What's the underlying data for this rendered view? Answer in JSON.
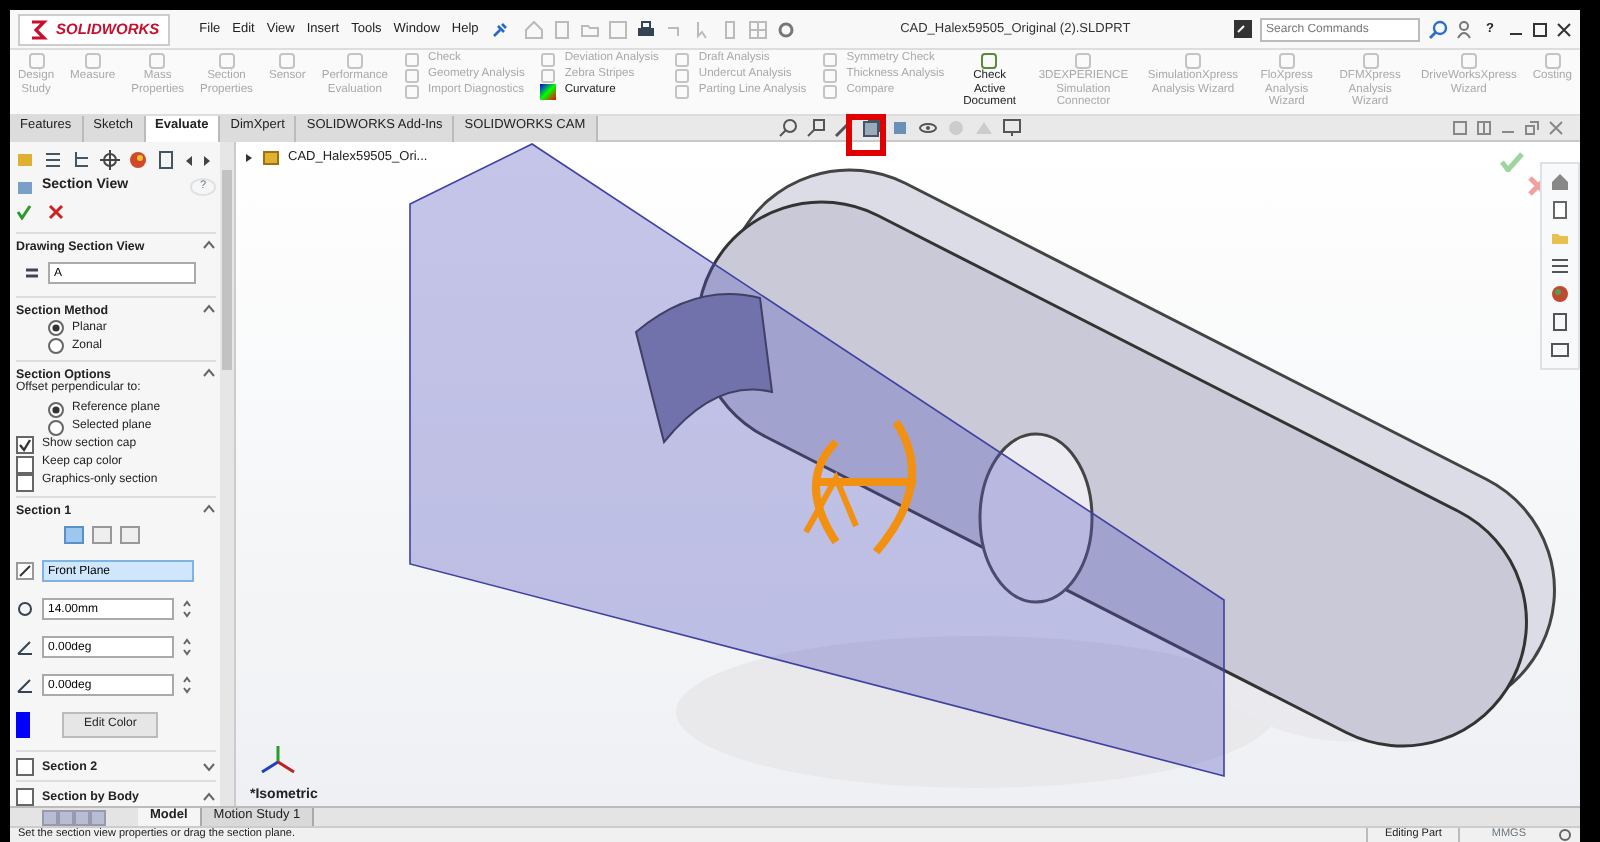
{
  "title_bar": {
    "logo_text": "SOLIDWORKS",
    "menus": [
      "File",
      "Edit",
      "View",
      "Insert",
      "Tools",
      "Window",
      "Help"
    ],
    "document_title": "CAD_Halex59505_Original (2).SLDPRT",
    "search": {
      "placeholder": "Search Commands"
    },
    "help_label": "?"
  },
  "ribbon": {
    "items": [
      {
        "kind": "large",
        "label": "Design Study",
        "disabled": true
      },
      {
        "kind": "large",
        "label": "Measure",
        "disabled": true
      },
      {
        "kind": "large",
        "label": "Mass Properties",
        "disabled": true
      },
      {
        "kind": "large",
        "label": "Section Properties",
        "disabled": true
      },
      {
        "kind": "large",
        "label": "Sensor",
        "disabled": true
      },
      {
        "kind": "large",
        "label": "Performance Evaluation",
        "disabled": true
      },
      {
        "kind": "stack",
        "entries": [
          {
            "label": "Check",
            "disabled": true
          },
          {
            "label": "Geometry Analysis",
            "disabled": true
          },
          {
            "label": "Import Diagnostics",
            "disabled": true
          }
        ]
      },
      {
        "kind": "stack",
        "entries": [
          {
            "label": "Deviation Analysis",
            "disabled": true
          },
          {
            "label": "Zebra Stripes",
            "disabled": true
          },
          {
            "label": "Curvature",
            "disabled": false
          }
        ]
      },
      {
        "kind": "stack",
        "entries": [
          {
            "label": "Draft Analysis",
            "disabled": true
          },
          {
            "label": "Undercut Analysis",
            "disabled": true
          },
          {
            "label": "Parting Line Analysis",
            "disabled": true
          }
        ]
      },
      {
        "kind": "stack",
        "entries": [
          {
            "label": "Symmetry Check",
            "disabled": true
          },
          {
            "label": "Thickness Analysis",
            "disabled": true
          },
          {
            "label": "Compare",
            "disabled": true
          }
        ]
      },
      {
        "kind": "large",
        "label": "Check Active Document",
        "disabled": false
      },
      {
        "kind": "large",
        "label": "3DEXPERIENCE Simulation Connector",
        "disabled": true
      },
      {
        "kind": "large",
        "label": "SimulationXpress Analysis Wizard",
        "disabled": true
      },
      {
        "kind": "large",
        "label": "FloXpress Analysis Wizard",
        "disabled": true
      },
      {
        "kind": "large",
        "label": "DFMXpress Analysis Wizard",
        "disabled": true
      },
      {
        "kind": "large",
        "label": "DriveWorksXpress Wizard",
        "disabled": true
      },
      {
        "kind": "large",
        "label": "Costing",
        "disabled": true
      }
    ]
  },
  "command_tabs": [
    {
      "label": "Features",
      "selected": false
    },
    {
      "label": "Sketch",
      "selected": false
    },
    {
      "label": "Evaluate",
      "selected": true
    },
    {
      "label": "DimXpert",
      "selected": false
    },
    {
      "label": "SOLIDWORKS Add-Ins",
      "selected": false
    },
    {
      "label": "SOLIDWORKS CAM",
      "selected": false
    }
  ],
  "feature_tree": {
    "root": "CAD_Halex59505_Ori..."
  },
  "property_manager": {
    "title": "Section View",
    "help_label": "?",
    "drawing_section_view": {
      "title": "Drawing Section View",
      "expanded": true,
      "value": "A"
    },
    "section_method": {
      "title": "Section Method",
      "expanded": true,
      "options": [
        {
          "label": "Planar",
          "selected": true
        },
        {
          "label": "Zonal",
          "selected": false
        }
      ]
    },
    "section_options": {
      "title": "Section Options",
      "expanded": true,
      "prompt": "Offset perpendicular to:",
      "options": [
        {
          "label": "Reference plane",
          "selected": true
        },
        {
          "label": "Selected plane",
          "selected": false
        }
      ],
      "checks": [
        {
          "label": "Show section cap",
          "checked": true
        },
        {
          "label": "Keep cap color",
          "checked": false
        },
        {
          "label": "Graphics-only section",
          "checked": false
        }
      ]
    },
    "section_1": {
      "title": "Section 1",
      "expanded": true,
      "modes": [
        {
          "selected": true
        },
        {
          "selected": false
        },
        {
          "selected": false
        }
      ],
      "plane": "Front Plane",
      "offset": "14.00mm",
      "angle_1": "0.00deg",
      "angle_2": "0.00deg",
      "color": "#0000ff",
      "color_button": "Edit Color"
    },
    "more_sections": [
      {
        "label": "Section 2",
        "checked": false,
        "expanded": false
      },
      {
        "label": "Section by Body",
        "checked": false,
        "expanded": true
      }
    ]
  },
  "viewport": {
    "view_label": "*Isometric"
  },
  "bottom_tabs": [
    {
      "label": "Model",
      "selected": true
    },
    {
      "label": "Motion Study 1",
      "selected": false
    }
  ],
  "status_bar": {
    "message": "Set the section view properties or drag the section plane.",
    "mode": "Editing Part",
    "units": "MMGS"
  }
}
